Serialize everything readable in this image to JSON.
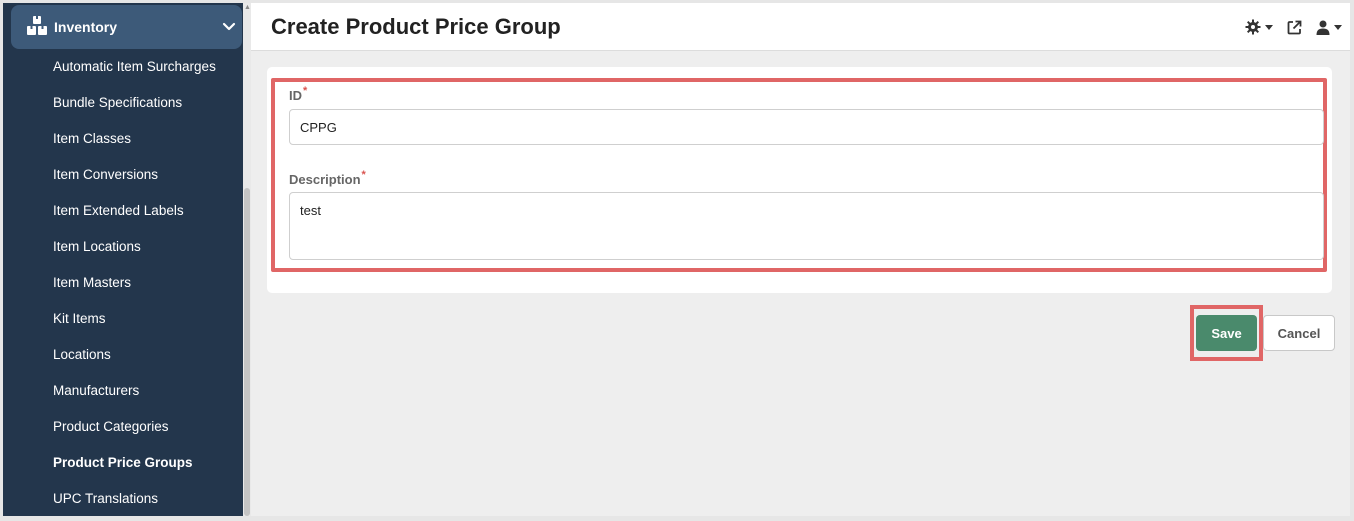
{
  "sidebar": {
    "section_label": "Inventory",
    "items": [
      {
        "label": "Automatic Item Surcharges",
        "active": false
      },
      {
        "label": "Bundle Specifications",
        "active": false
      },
      {
        "label": "Item Classes",
        "active": false
      },
      {
        "label": "Item Conversions",
        "active": false
      },
      {
        "label": "Item Extended Labels",
        "active": false
      },
      {
        "label": "Item Locations",
        "active": false
      },
      {
        "label": "Item Masters",
        "active": false
      },
      {
        "label": "Kit Items",
        "active": false
      },
      {
        "label": "Locations",
        "active": false
      },
      {
        "label": "Manufacturers",
        "active": false
      },
      {
        "label": "Product Categories",
        "active": false
      },
      {
        "label": "Product Price Groups",
        "active": true
      },
      {
        "label": "UPC Translations",
        "active": false
      }
    ]
  },
  "header": {
    "title": "Create Product Price Group",
    "icons": [
      "gear-icon",
      "external-link-icon",
      "user-icon"
    ]
  },
  "form": {
    "id_label": "ID",
    "id_required": "*",
    "id_value": "CPPG",
    "description_label": "Description",
    "description_required": "*",
    "description_value": "test"
  },
  "actions": {
    "save_label": "Save",
    "cancel_label": "Cancel"
  },
  "colors": {
    "sidebar_bg": "#23364c",
    "sidebar_header_bg": "#3d5a79",
    "save_button": "#4a8a6c",
    "highlight": "#e06666",
    "required": "#d9534f"
  }
}
